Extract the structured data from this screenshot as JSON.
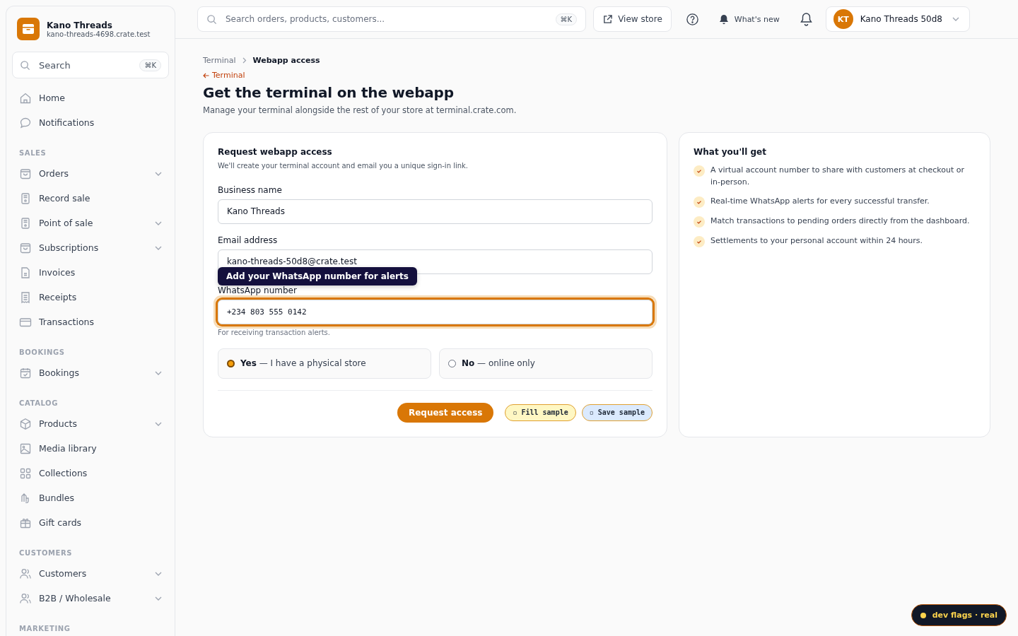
{
  "sidebar": {
    "store_name": "Kano Threads",
    "store_domain": "kano-threads-4698.crate.test",
    "search": {
      "placeholder": "Search",
      "shortcut": "⌘K"
    },
    "top_items": [
      {
        "label": "Home"
      },
      {
        "label": "Notifications"
      }
    ],
    "sections": [
      {
        "heading": "SALES",
        "items": [
          {
            "label": "Orders",
            "expandable": true
          },
          {
            "label": "Record sale",
            "expandable": false
          },
          {
            "label": "Point of sale",
            "expandable": true
          },
          {
            "label": "Subscriptions",
            "expandable": true
          },
          {
            "label": "Invoices",
            "expandable": false
          },
          {
            "label": "Receipts",
            "expandable": false
          },
          {
            "label": "Transactions",
            "expandable": false
          }
        ]
      },
      {
        "heading": "BOOKINGS",
        "items": [
          {
            "label": "Bookings",
            "expandable": true
          }
        ]
      },
      {
        "heading": "CATALOG",
        "items": [
          {
            "label": "Products",
            "expandable": true
          },
          {
            "label": "Media library",
            "expandable": false
          },
          {
            "label": "Collections",
            "expandable": false
          },
          {
            "label": "Bundles",
            "expandable": false
          },
          {
            "label": "Gift cards",
            "expandable": false
          }
        ]
      },
      {
        "heading": "CUSTOMERS",
        "items": [
          {
            "label": "Customers",
            "expandable": true
          },
          {
            "label": "B2B / Wholesale",
            "expandable": true
          }
        ]
      },
      {
        "heading": "MARKETING"
      }
    ]
  },
  "topbar": {
    "search": {
      "placeholder": "Search orders, products, customers...",
      "shortcut": "⌘K"
    },
    "view_store": "View store",
    "whats_new": "What's new",
    "account": {
      "initials": "KT",
      "name": "Kano Threads 50d8"
    }
  },
  "breadcrumb": [
    "Terminal",
    "Webapp access"
  ],
  "back_link": "Terminal",
  "title": "Get the terminal on the webapp",
  "subtitle": "Manage your terminal alongside the rest of your store at terminal.crate.com.",
  "form": {
    "title": "Request webapp access",
    "description": "We'll create your terminal account and email you a unique sign-in link.",
    "fields": [
      {
        "label": "Business name",
        "value": "Kano Threads",
        "kind": "text",
        "focused": false
      },
      {
        "label": "Email address",
        "value": "kano-threads-50d8@crate.test",
        "kind": "text",
        "focused": false
      },
      {
        "label": "WhatsApp number",
        "value": "+234 803 555 0142",
        "kind": "phone",
        "focused": true,
        "helper": "For receiving transaction alerts.",
        "tooltip": "Add your WhatsApp number for alerts"
      }
    ],
    "options": [
      {
        "strong": "Yes",
        "rest": " — I have a physical store",
        "selected": true
      },
      {
        "strong": "No",
        "rest": " — online only",
        "selected": false
      }
    ],
    "submit": "Request access",
    "fill_sample": "▫ Fill sample",
    "save_sample": "▫ Save sample"
  },
  "benefits": {
    "title": "What you'll get",
    "items": [
      "A virtual account number to share with customers at checkout or in-person.",
      "Real-time WhatsApp alerts for every successful transfer.",
      "Match transactions to pending orders directly from the dashboard.",
      "Settlements to your personal account within 24 hours."
    ]
  },
  "dev_badge": "dev flags · real"
}
